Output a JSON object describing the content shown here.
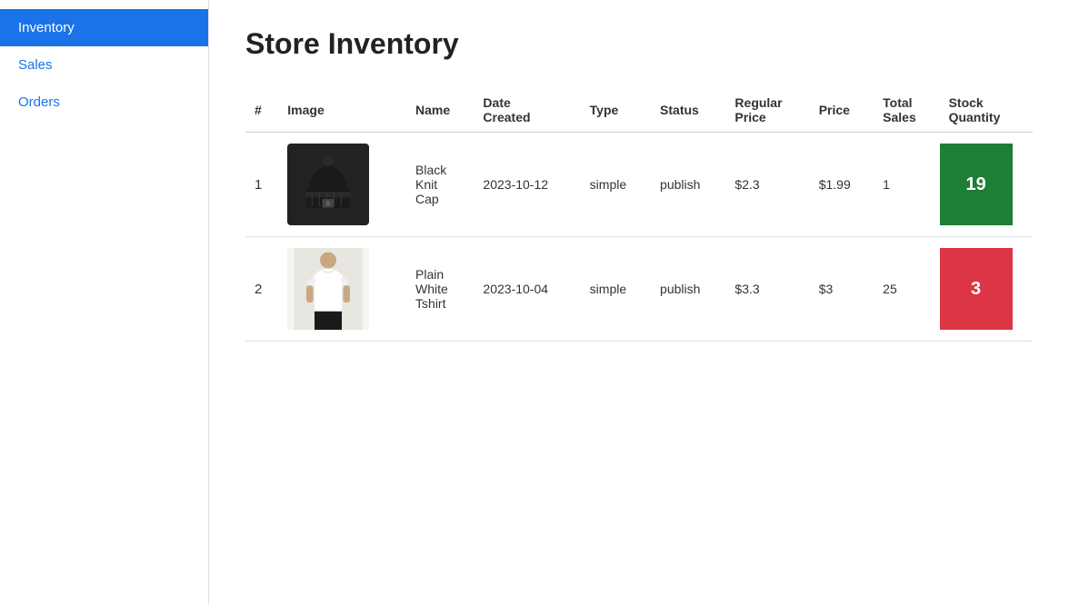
{
  "sidebar": {
    "items": [
      {
        "label": "Inventory",
        "active": true,
        "id": "inventory"
      },
      {
        "label": "Sales",
        "active": false,
        "id": "sales"
      },
      {
        "label": "Orders",
        "active": false,
        "id": "orders"
      }
    ]
  },
  "main": {
    "title": "Store Inventory",
    "table": {
      "headers": [
        "#",
        "Image",
        "Name",
        "Date Created",
        "Type",
        "Status",
        "Regular Price",
        "Price",
        "Total Sales",
        "Stock Quantity"
      ],
      "rows": [
        {
          "number": "1",
          "name": "Black Knit Cap",
          "name_line1": "Black",
          "name_line2": "Knit",
          "name_line3": "Cap",
          "date_created": "2023-10-12",
          "type": "simple",
          "status": "publish",
          "regular_price": "$2.3",
          "price": "$1.99",
          "total_sales": "1",
          "stock_quantity": "19",
          "stock_color": "green",
          "image_type": "beanie"
        },
        {
          "number": "2",
          "name": "Plain White Tshirt",
          "name_line1": "Plain",
          "name_line2": "White",
          "name_line3": "Tshirt",
          "date_created": "2023-10-04",
          "type": "simple",
          "status": "publish",
          "regular_price": "$3.3",
          "price": "$3",
          "total_sales": "25",
          "stock_quantity": "3",
          "stock_color": "red",
          "image_type": "shirt"
        }
      ]
    }
  },
  "colors": {
    "sidebar_active_bg": "#1a73e8",
    "stock_green": "#1e7e34",
    "stock_red": "#dc3545",
    "link_color": "#1a73e8"
  }
}
